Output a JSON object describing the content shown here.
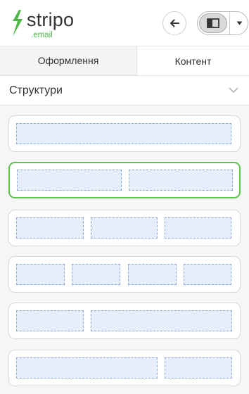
{
  "brand": {
    "name": "stripo",
    "suffix": ".email",
    "accent_color": "#4db848"
  },
  "header": {
    "back_icon": "arrow-left-icon",
    "layout_icon": "sidebar-layout-icon",
    "dropdown_icon": "caret-down-icon"
  },
  "tabs": [
    {
      "label": "Оформлення",
      "active": false
    },
    {
      "label": "Контент",
      "active": true
    }
  ],
  "section": {
    "title": "Структури",
    "expanded": true,
    "chevron_icon": "chevron-down-icon"
  },
  "structures": [
    {
      "columns": "1",
      "selected": false
    },
    {
      "columns": "1/2 + 1/2",
      "selected": true
    },
    {
      "columns": "1/3 + 1/3 + 1/3",
      "selected": false
    },
    {
      "columns": "1/4 + 1/4 + 1/4 + 1/4",
      "selected": false
    },
    {
      "columns": "1/3 + 2/3",
      "selected": false
    },
    {
      "columns": "2/3 + 1/3",
      "selected": false
    }
  ],
  "colors": {
    "selected_border": "#5fc24f",
    "column_fill": "#e6eefb",
    "column_border": "#8aa9d6"
  }
}
